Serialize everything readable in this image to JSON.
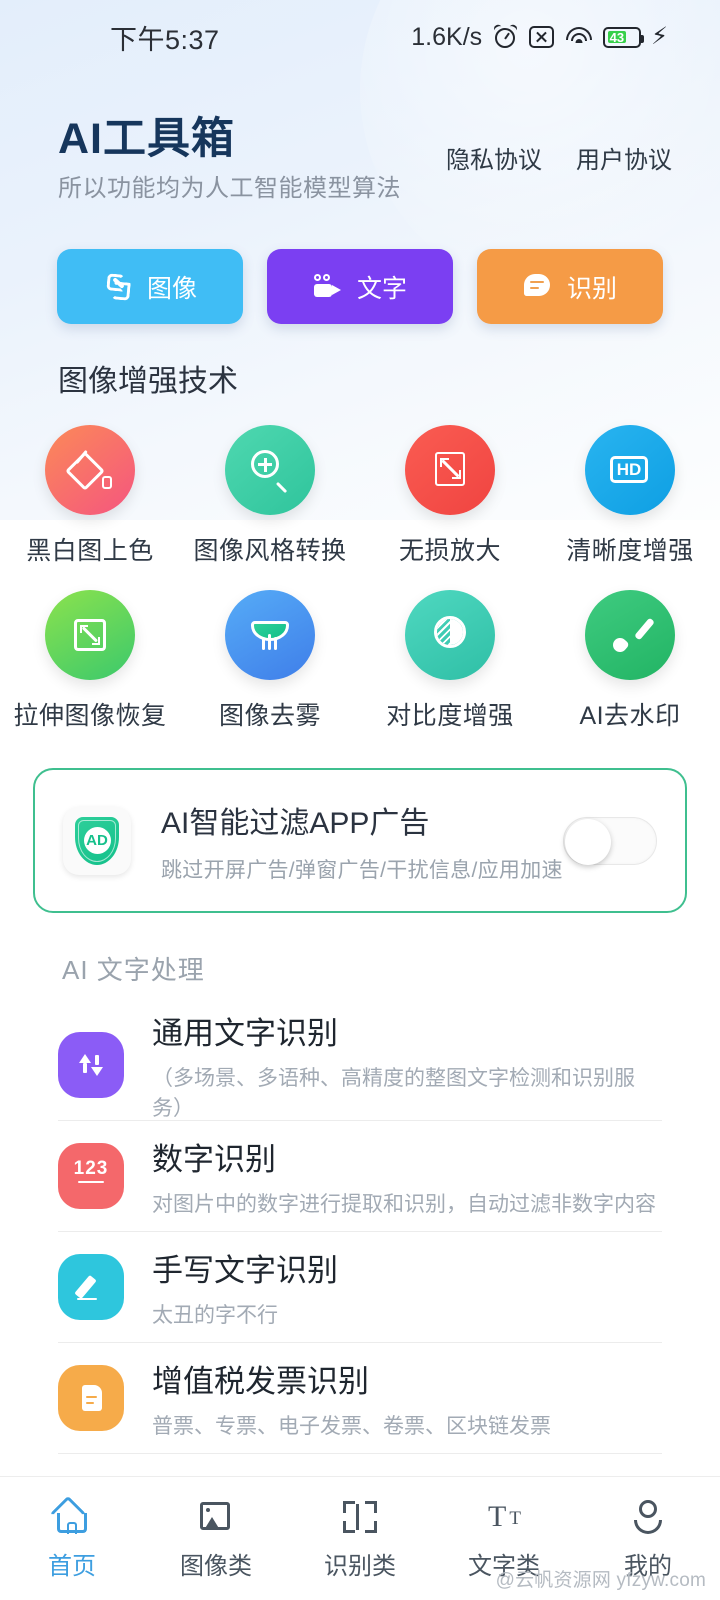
{
  "status_bar": {
    "time": "下午5:37",
    "network_speed": "1.6K/s",
    "battery_level": "43",
    "icons": [
      "alarm-icon",
      "mute-icon",
      "wifi-icon",
      "battery-icon",
      "charging-bolt-icon"
    ]
  },
  "header": {
    "title": "AI工具箱",
    "subtitle": "所以功能均为人工智能模型算法",
    "links": [
      {
        "label": "隐私协议"
      },
      {
        "label": "用户协议"
      }
    ]
  },
  "categories": [
    {
      "label": "图像",
      "icon": "phone-icon",
      "color": "#40bdf5"
    },
    {
      "label": "文字",
      "icon": "video-camera-icon",
      "color": "#7b3ff2"
    },
    {
      "label": "识别",
      "icon": "chat-bubble-icon",
      "color": "#f59b46"
    }
  ],
  "image_section": {
    "title": "图像增强技术",
    "tools": [
      {
        "label": "黑白图上色",
        "icon": "colorize-icon",
        "color": "#f97c5c"
      },
      {
        "label": "图像风格转换",
        "icon": "zoom-in-icon",
        "color": "#3ecfa8"
      },
      {
        "label": "无损放大",
        "icon": "expand-icon",
        "color": "#f5514c"
      },
      {
        "label": "清晰度增强",
        "icon": "hd-icon",
        "color": "#1aa8ea"
      },
      {
        "label": "拉伸图像恢复",
        "icon": "crop-restore-icon",
        "color": "#6fd94c"
      },
      {
        "label": "图像去雾",
        "icon": "defog-icon",
        "color": "#4c9cf0"
      },
      {
        "label": "对比度增强",
        "icon": "contrast-icon",
        "color": "#3fcfb0"
      },
      {
        "label": "AI去水印",
        "icon": "brush-icon",
        "color": "#2fbf72"
      }
    ]
  },
  "ad_card": {
    "icon": "ad-shield-icon",
    "badge_text": "AD",
    "title": "AI智能过滤APP广告",
    "subtitle": "跳过开屏广告/弹窗广告/干扰信息/应用加速",
    "toggle_state": "off",
    "border_color": "#3fbf8f"
  },
  "text_section": {
    "title": "AI 文字处理",
    "items": [
      {
        "title": "通用文字识别",
        "subtitle": "（多场景、多语种、高精度的整图文字检测和识别服务）",
        "icon": "ocr-icon",
        "color": "#8b5cf6"
      },
      {
        "title": "数字识别",
        "subtitle": "对图片中的数字进行提取和识别，自动过滤非数字内容",
        "icon": "number-123-icon",
        "color": "#f4686b"
      },
      {
        "title": "手写文字识别",
        "subtitle": "太丑的字不行",
        "icon": "pencil-icon",
        "color": "#2ec6dd"
      },
      {
        "title": "增值税发票识别",
        "subtitle": "普票、专票、电子发票、卷票、区块链发票",
        "icon": "document-icon",
        "color": "#f6ab4a"
      }
    ]
  },
  "bottom_nav": {
    "active_color": "#3d9ee0",
    "items": [
      {
        "label": "首页",
        "icon": "home-icon",
        "active": true
      },
      {
        "label": "图像类",
        "icon": "image-icon",
        "active": false
      },
      {
        "label": "识别类",
        "icon": "scan-icon",
        "active": false
      },
      {
        "label": "文字类",
        "icon": "text-size-icon",
        "active": false
      },
      {
        "label": "我的",
        "icon": "person-icon",
        "active": false
      }
    ]
  },
  "watermark": "@云帆资源网 yfzyw.com"
}
